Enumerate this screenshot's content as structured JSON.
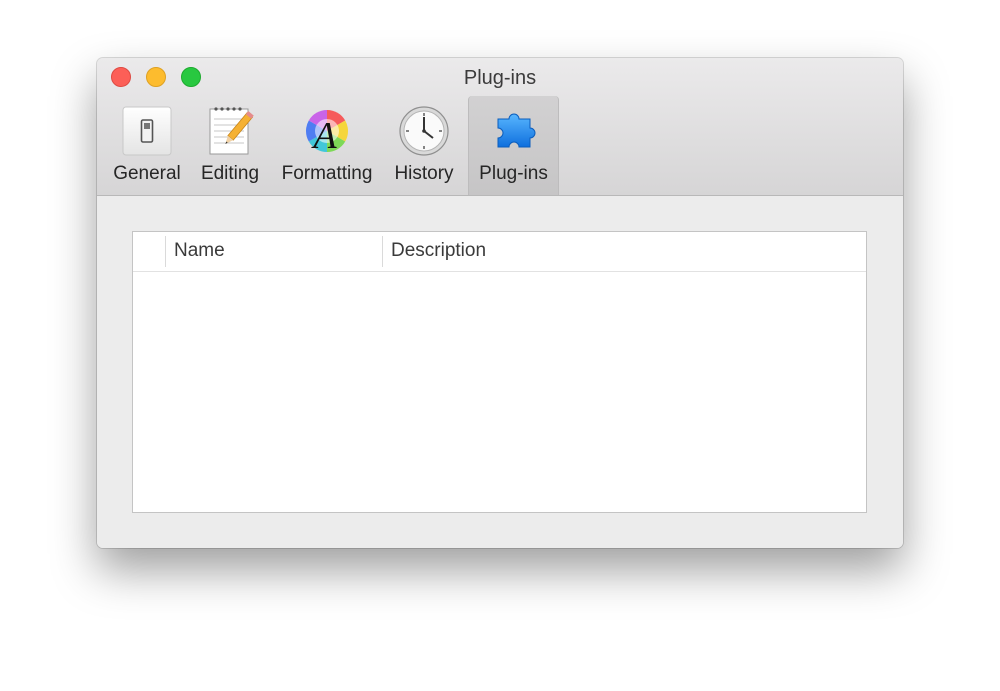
{
  "window": {
    "title": "Plug-ins"
  },
  "toolbar": {
    "items": [
      {
        "label": "General",
        "icon": "switch-icon"
      },
      {
        "label": "Editing",
        "icon": "notepad-pencil-icon"
      },
      {
        "label": "Formatting",
        "icon": "color-wheel-a-icon"
      },
      {
        "label": "History",
        "icon": "clock-icon"
      },
      {
        "label": "Plug-ins",
        "icon": "puzzle-piece-icon",
        "selected": true
      }
    ]
  },
  "plugins_table": {
    "columns": [
      "Name",
      "Description"
    ],
    "rows": []
  },
  "colors": {
    "close": "#fc5f57",
    "minimize": "#fdbc2e",
    "zoom": "#28c840",
    "puzzle": "#1e8bf0"
  }
}
